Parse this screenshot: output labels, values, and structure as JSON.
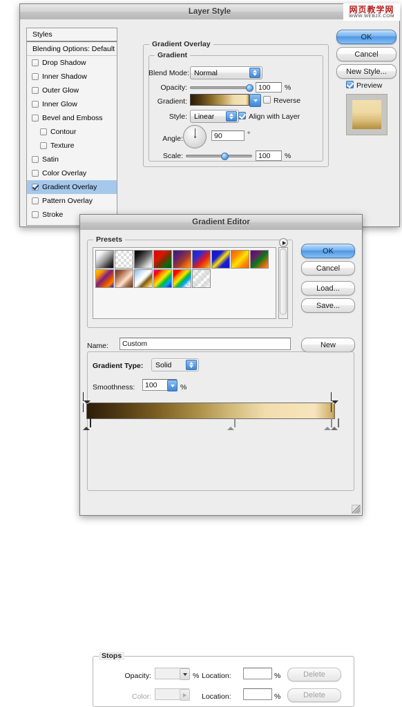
{
  "watermark": {
    "cn": "网页教学网",
    "en": "WWW.WEBJX.COM"
  },
  "layer_style": {
    "title": "Layer Style",
    "styles_list": {
      "header": "Styles",
      "blending_options": "Blending Options: Default",
      "items": [
        {
          "label": "Drop Shadow",
          "checked": false,
          "indent": false,
          "selected": false
        },
        {
          "label": "Inner Shadow",
          "checked": false,
          "indent": false,
          "selected": false
        },
        {
          "label": "Outer Glow",
          "checked": false,
          "indent": false,
          "selected": false
        },
        {
          "label": "Inner Glow",
          "checked": false,
          "indent": false,
          "selected": false
        },
        {
          "label": "Bevel and Emboss",
          "checked": false,
          "indent": false,
          "selected": false
        },
        {
          "label": "Contour",
          "checked": false,
          "indent": true,
          "selected": false
        },
        {
          "label": "Texture",
          "checked": false,
          "indent": true,
          "selected": false
        },
        {
          "label": "Satin",
          "checked": false,
          "indent": false,
          "selected": false
        },
        {
          "label": "Color Overlay",
          "checked": false,
          "indent": false,
          "selected": false
        },
        {
          "label": "Gradient Overlay",
          "checked": true,
          "indent": false,
          "selected": true
        },
        {
          "label": "Pattern Overlay",
          "checked": false,
          "indent": false,
          "selected": false
        },
        {
          "label": "Stroke",
          "checked": false,
          "indent": false,
          "selected": false
        }
      ]
    },
    "panel": {
      "group_title": "Gradient Overlay",
      "sub_group_title": "Gradient",
      "blend_mode_label": "Blend Mode:",
      "blend_mode_value": "Normal",
      "opacity_label": "Opacity:",
      "opacity_value": "100",
      "opacity_unit": "%",
      "gradient_label": "Gradient:",
      "reverse_label": "Reverse",
      "reverse_checked": false,
      "style_label": "Style:",
      "style_value": "Linear",
      "align_label": "Align with Layer",
      "align_checked": true,
      "angle_label": "Angle:",
      "angle_value": "90",
      "angle_unit": "°",
      "scale_label": "Scale:",
      "scale_value": "100",
      "scale_unit": "%"
    },
    "buttons": {
      "ok": "OK",
      "cancel": "Cancel",
      "new_style": "New Style...",
      "preview_label": "Preview",
      "preview_checked": true
    }
  },
  "gradient_editor": {
    "title": "Gradient Editor",
    "presets": {
      "group_title": "Presets",
      "row1": [
        "foreground-to-background",
        "foreground-to-transparent",
        "black-white",
        "red-green",
        "violet-orange",
        "blue-red-yellow",
        "blue-yellow-blue",
        "orange-yellow-orange",
        "violet-green-orange"
      ],
      "row2": [
        "yellow-violet-orange-blue",
        "copper",
        "chrome",
        "spectrum",
        "transparent-rainbow",
        "transparent-stripes"
      ]
    },
    "name_label": "Name:",
    "name_value": "Custom",
    "new_button": "New",
    "gradient_type_label": "Gradient Type:",
    "gradient_type_value": "Solid",
    "smoothness_label": "Smoothness:",
    "smoothness_value": "100",
    "smoothness_unit": "%",
    "stops": {
      "group_title": "Stops",
      "opacity_label": "Opacity:",
      "opacity_value": "",
      "opacity_unit": "%",
      "opacity_location_label": "Location:",
      "opacity_location_value": "",
      "opacity_location_unit": "%",
      "opacity_delete": "Delete",
      "color_label": "Color:",
      "color_location_label": "Location:",
      "color_location_value": "",
      "color_location_unit": "%",
      "color_delete": "Delete"
    },
    "buttons": {
      "ok": "OK",
      "cancel": "Cancel",
      "load": "Load...",
      "save": "Save..."
    },
    "gradient_stops": {
      "opacity_stops": [
        {
          "location": 0
        },
        {
          "location": 100
        }
      ],
      "color_stops": [
        {
          "location": 0,
          "color": "#2d1e08"
        },
        {
          "location": 58,
          "color": "#d9bd7e"
        },
        {
          "location": 97,
          "color": "#f6e5bd"
        },
        {
          "location": 100,
          "color": "#c8a85e"
        }
      ]
    }
  },
  "colors": {
    "accent": "#4f97e6",
    "selection": "#a5c8ec",
    "window_bg": "#ededed",
    "gradient_dark": "#2d1e08",
    "gradient_mid": "#a98d44",
    "gradient_light": "#f6e5bd"
  }
}
